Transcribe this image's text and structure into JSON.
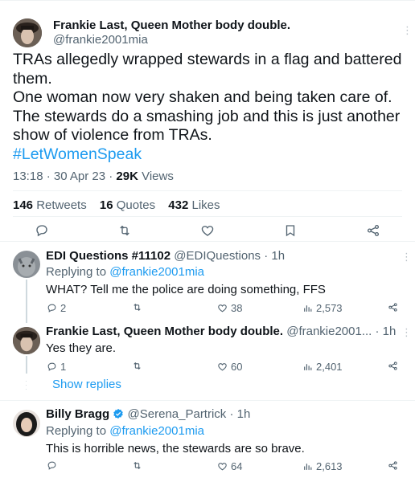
{
  "main_tweet": {
    "display_name": "Frankie Last, Queen Mother body double.",
    "handle": "@frankie2001mia",
    "text_lines": [
      "TRAs allegedly wrapped stewards in a flag and battered",
      "them.",
      "One woman now very shaken and being taken care of.",
      "The stewards do a smashing job and this is just another",
      "show of violence from TRAs."
    ],
    "hashtag": "#LetWomenSpeak",
    "timestamp": "13:18 · 30 Apr 23 · ",
    "views_count": "29K",
    "views_label": " Views",
    "retweets_count": "146",
    "retweets_label": " Retweets",
    "quotes_count": "16",
    "quotes_label": " Quotes",
    "likes_count": "432",
    "likes_label": " Likes"
  },
  "replies": [
    {
      "display_name": "EDI Questions #11102",
      "handle": "@EDIQuestions · 1h",
      "replying_prefix": "Replying to ",
      "replying_to": "@frankie2001mia",
      "text": "WHAT? Tell me the police are doing something, FFS",
      "replies": "2",
      "likes": "38",
      "views": "2,573"
    },
    {
      "display_name": "Frankie Last, Queen Mother body double.",
      "handle": "@frankie2001... · 1h",
      "text": "Yes they are.",
      "replies": "1",
      "likes": "60",
      "views": "2,401"
    },
    {
      "display_name": "Billy Bragg",
      "handle": "@Serena_Partrick · 1h",
      "replying_prefix": "Replying to ",
      "replying_to": "@frankie2001mia",
      "text": "This is horrible news, the stewards are so brave.",
      "likes": "64",
      "views": "2,613"
    }
  ],
  "show_replies_label": "Show replies",
  "colors": {
    "accent": "#1d9bf0",
    "secondary_text": "#536471",
    "divider": "#eff3f4"
  }
}
